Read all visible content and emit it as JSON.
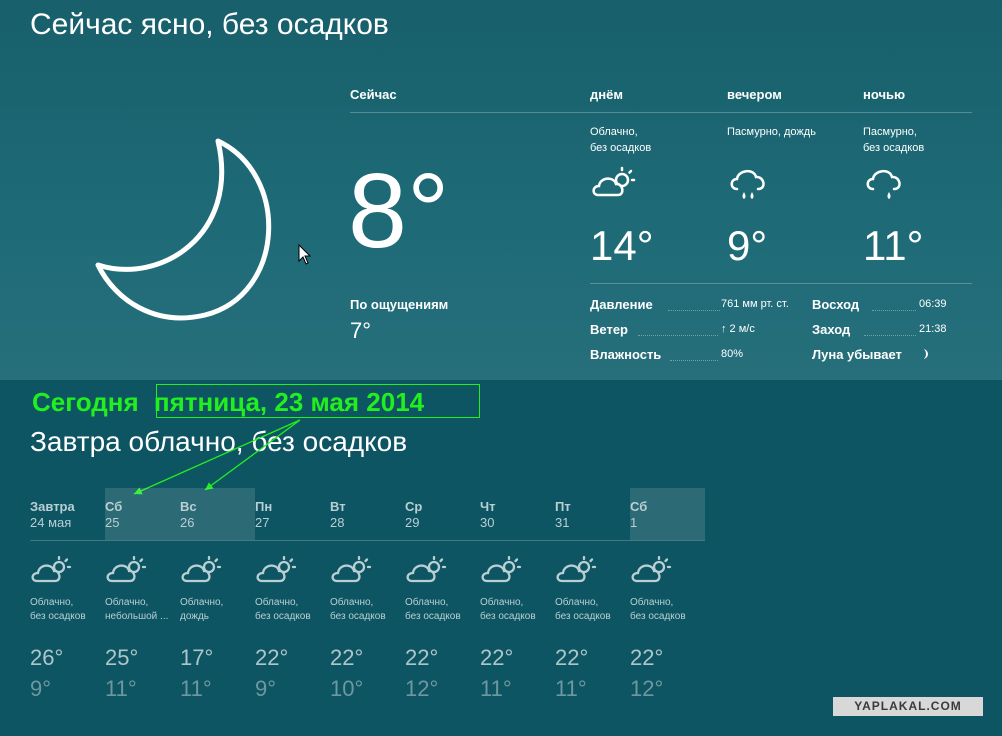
{
  "headline": "Сейчас ясно, без осадков",
  "now": {
    "label": "Сейчас",
    "temp": "8°",
    "feels_label": "По ощущениям",
    "feels_value": "7°"
  },
  "periods": [
    {
      "label": "днём",
      "desc1": "Облачно,",
      "desc2": "без осадков",
      "temp": "14°",
      "icon": "partly-cloudy-icon"
    },
    {
      "label": "вечером",
      "desc1": "Пасмурно, дождь",
      "desc2": "",
      "temp": "9°",
      "icon": "rain-cloud-icon"
    },
    {
      "label": "ночью",
      "desc1": "Пасмурно,",
      "desc2": "без осадков",
      "temp": "11°",
      "icon": "cloud-drizzle-icon"
    }
  ],
  "details": {
    "pressure_label": "Давление",
    "pressure_value": "761 мм рт. ст.",
    "wind_label": "Ветер",
    "wind_value": "↑ 2 м/с",
    "humidity_label": "Влажность",
    "humidity_value": "80%",
    "sunrise_label": "Восход",
    "sunrise_value": "06:39",
    "sunset_label": "Заход",
    "sunset_value": "21:38",
    "moon_label": "Луна убывает"
  },
  "annotation": {
    "prefix": "Сегодня",
    "date": "пятница, 23 мая 2014"
  },
  "tomorrow": "Завтра облачно, без осадков",
  "forecast": [
    {
      "day": "Завтра",
      "date": "24 мая",
      "desc1": "Облачно,",
      "desc2": "без осадков",
      "hi": "26°",
      "lo": "9°"
    },
    {
      "day": "Сб",
      "date": "25",
      "desc1": "Облачно,",
      "desc2": "небольшой ...",
      "hi": "25°",
      "lo": "11°"
    },
    {
      "day": "Вс",
      "date": "26",
      "desc1": "Облачно,",
      "desc2": "дождь",
      "hi": "17°",
      "lo": "11°"
    },
    {
      "day": "Пн",
      "date": "27",
      "desc1": "Облачно,",
      "desc2": "без осадков",
      "hi": "22°",
      "lo": "9°"
    },
    {
      "day": "Вт",
      "date": "28",
      "desc1": "Облачно,",
      "desc2": "без осадков",
      "hi": "22°",
      "lo": "10°"
    },
    {
      "day": "Ср",
      "date": "29",
      "desc1": "Облачно,",
      "desc2": "без осадков",
      "hi": "22°",
      "lo": "12°"
    },
    {
      "day": "Чт",
      "date": "30",
      "desc1": "Облачно,",
      "desc2": "без осадков",
      "hi": "22°",
      "lo": "11°"
    },
    {
      "day": "Пт",
      "date": "31",
      "desc1": "Облачно,",
      "desc2": "без осадков",
      "hi": "22°",
      "lo": "11°"
    },
    {
      "day": "Сб",
      "date": "1",
      "desc1": "Облачно,",
      "desc2": "без осадков",
      "hi": "22°",
      "lo": "12°"
    }
  ],
  "watermark": "YAPLAKAL.COM",
  "colors": {
    "annotation": "#22f01e",
    "weekend_bg": "rgba(255,255,255,0.13)"
  }
}
